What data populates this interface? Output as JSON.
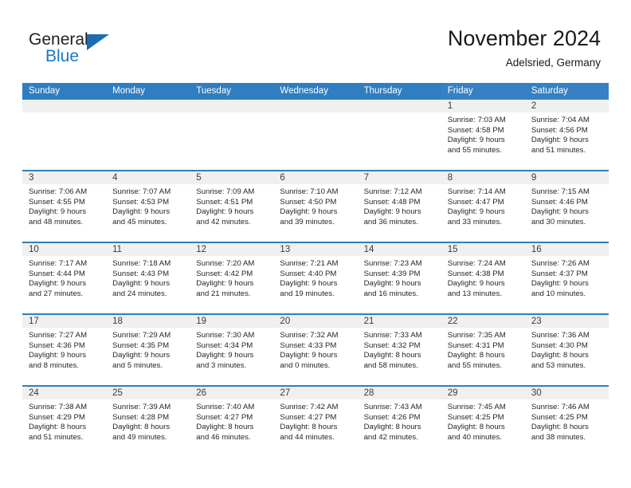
{
  "logo": {
    "word1": "General",
    "word2": "Blue",
    "triangle_color": "#1b6cb3",
    "word1_color": "#231f20",
    "word2_color": "#1b77c4"
  },
  "header": {
    "title": "November 2024",
    "subtitle": "Adelsried, Germany"
  },
  "theme": {
    "header_blue": "#2f7ec1",
    "header_blue_alt": "#3581c3",
    "day_number_band": "#f0f0f0",
    "text": "#262626"
  },
  "weekday_headers": [
    "Sunday",
    "Monday",
    "Tuesday",
    "Wednesday",
    "Thursday",
    "Friday",
    "Saturday"
  ],
  "weeks": [
    [
      {
        "day": "",
        "lines": []
      },
      {
        "day": "",
        "lines": []
      },
      {
        "day": "",
        "lines": []
      },
      {
        "day": "",
        "lines": []
      },
      {
        "day": "",
        "lines": []
      },
      {
        "day": "1",
        "lines": [
          "Sunrise: 7:03 AM",
          "Sunset: 4:58 PM",
          "Daylight: 9 hours",
          "and 55 minutes."
        ]
      },
      {
        "day": "2",
        "lines": [
          "Sunrise: 7:04 AM",
          "Sunset: 4:56 PM",
          "Daylight: 9 hours",
          "and 51 minutes."
        ]
      }
    ],
    [
      {
        "day": "3",
        "lines": [
          "Sunrise: 7:06 AM",
          "Sunset: 4:55 PM",
          "Daylight: 9 hours",
          "and 48 minutes."
        ]
      },
      {
        "day": "4",
        "lines": [
          "Sunrise: 7:07 AM",
          "Sunset: 4:53 PM",
          "Daylight: 9 hours",
          "and 45 minutes."
        ]
      },
      {
        "day": "5",
        "lines": [
          "Sunrise: 7:09 AM",
          "Sunset: 4:51 PM",
          "Daylight: 9 hours",
          "and 42 minutes."
        ]
      },
      {
        "day": "6",
        "lines": [
          "Sunrise: 7:10 AM",
          "Sunset: 4:50 PM",
          "Daylight: 9 hours",
          "and 39 minutes."
        ]
      },
      {
        "day": "7",
        "lines": [
          "Sunrise: 7:12 AM",
          "Sunset: 4:48 PM",
          "Daylight: 9 hours",
          "and 36 minutes."
        ]
      },
      {
        "day": "8",
        "lines": [
          "Sunrise: 7:14 AM",
          "Sunset: 4:47 PM",
          "Daylight: 9 hours",
          "and 33 minutes."
        ]
      },
      {
        "day": "9",
        "lines": [
          "Sunrise: 7:15 AM",
          "Sunset: 4:46 PM",
          "Daylight: 9 hours",
          "and 30 minutes."
        ]
      }
    ],
    [
      {
        "day": "10",
        "lines": [
          "Sunrise: 7:17 AM",
          "Sunset: 4:44 PM",
          "Daylight: 9 hours",
          "and 27 minutes."
        ]
      },
      {
        "day": "11",
        "lines": [
          "Sunrise: 7:18 AM",
          "Sunset: 4:43 PM",
          "Daylight: 9 hours",
          "and 24 minutes."
        ]
      },
      {
        "day": "12",
        "lines": [
          "Sunrise: 7:20 AM",
          "Sunset: 4:42 PM",
          "Daylight: 9 hours",
          "and 21 minutes."
        ]
      },
      {
        "day": "13",
        "lines": [
          "Sunrise: 7:21 AM",
          "Sunset: 4:40 PM",
          "Daylight: 9 hours",
          "and 19 minutes."
        ]
      },
      {
        "day": "14",
        "lines": [
          "Sunrise: 7:23 AM",
          "Sunset: 4:39 PM",
          "Daylight: 9 hours",
          "and 16 minutes."
        ]
      },
      {
        "day": "15",
        "lines": [
          "Sunrise: 7:24 AM",
          "Sunset: 4:38 PM",
          "Daylight: 9 hours",
          "and 13 minutes."
        ]
      },
      {
        "day": "16",
        "lines": [
          "Sunrise: 7:26 AM",
          "Sunset: 4:37 PM",
          "Daylight: 9 hours",
          "and 10 minutes."
        ]
      }
    ],
    [
      {
        "day": "17",
        "lines": [
          "Sunrise: 7:27 AM",
          "Sunset: 4:36 PM",
          "Daylight: 9 hours",
          "and 8 minutes."
        ]
      },
      {
        "day": "18",
        "lines": [
          "Sunrise: 7:29 AM",
          "Sunset: 4:35 PM",
          "Daylight: 9 hours",
          "and 5 minutes."
        ]
      },
      {
        "day": "19",
        "lines": [
          "Sunrise: 7:30 AM",
          "Sunset: 4:34 PM",
          "Daylight: 9 hours",
          "and 3 minutes."
        ]
      },
      {
        "day": "20",
        "lines": [
          "Sunrise: 7:32 AM",
          "Sunset: 4:33 PM",
          "Daylight: 9 hours",
          "and 0 minutes."
        ]
      },
      {
        "day": "21",
        "lines": [
          "Sunrise: 7:33 AM",
          "Sunset: 4:32 PM",
          "Daylight: 8 hours",
          "and 58 minutes."
        ]
      },
      {
        "day": "22",
        "lines": [
          "Sunrise: 7:35 AM",
          "Sunset: 4:31 PM",
          "Daylight: 8 hours",
          "and 55 minutes."
        ]
      },
      {
        "day": "23",
        "lines": [
          "Sunrise: 7:36 AM",
          "Sunset: 4:30 PM",
          "Daylight: 8 hours",
          "and 53 minutes."
        ]
      }
    ],
    [
      {
        "day": "24",
        "lines": [
          "Sunrise: 7:38 AM",
          "Sunset: 4:29 PM",
          "Daylight: 8 hours",
          "and 51 minutes."
        ]
      },
      {
        "day": "25",
        "lines": [
          "Sunrise: 7:39 AM",
          "Sunset: 4:28 PM",
          "Daylight: 8 hours",
          "and 49 minutes."
        ]
      },
      {
        "day": "26",
        "lines": [
          "Sunrise: 7:40 AM",
          "Sunset: 4:27 PM",
          "Daylight: 8 hours",
          "and 46 minutes."
        ]
      },
      {
        "day": "27",
        "lines": [
          "Sunrise: 7:42 AM",
          "Sunset: 4:27 PM",
          "Daylight: 8 hours",
          "and 44 minutes."
        ]
      },
      {
        "day": "28",
        "lines": [
          "Sunrise: 7:43 AM",
          "Sunset: 4:26 PM",
          "Daylight: 8 hours",
          "and 42 minutes."
        ]
      },
      {
        "day": "29",
        "lines": [
          "Sunrise: 7:45 AM",
          "Sunset: 4:25 PM",
          "Daylight: 8 hours",
          "and 40 minutes."
        ]
      },
      {
        "day": "30",
        "lines": [
          "Sunrise: 7:46 AM",
          "Sunset: 4:25 PM",
          "Daylight: 8 hours",
          "and 38 minutes."
        ]
      }
    ]
  ]
}
